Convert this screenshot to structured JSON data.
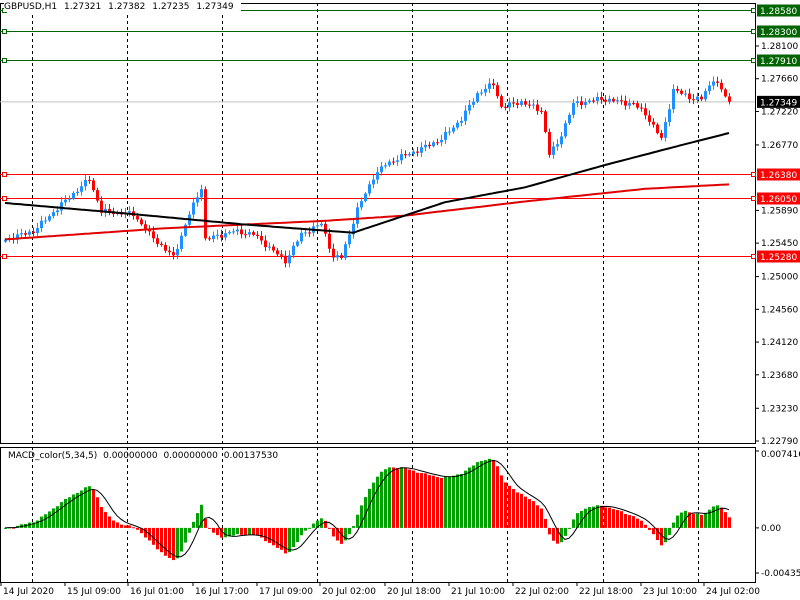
{
  "header": {
    "symbol": "GBPUSD,H1",
    "open": "1.27321",
    "high": "1.27382",
    "low": "1.27235",
    "close": "1.27349"
  },
  "macd": {
    "label": "MACD_color(5,34,5)",
    "v1": "0.00000000",
    "v2": "0.00000000",
    "v3": "0.00137530",
    "axis_top": "0.0074167",
    "axis_zero": "0.00",
    "axis_bottom": "-0.004350",
    "fast": 5,
    "slow": 34,
    "signal": 5
  },
  "colors": {
    "bull": "#1e90ff",
    "bear": "#ff0000",
    "green_line": "#006400",
    "red_line": "#ff0000",
    "ma_black": "#000000",
    "ma_red": "#e00000",
    "macd_up": "#00a000",
    "macd_down": "#ff0000"
  },
  "chart_data": {
    "type": "candlestick",
    "price_range": [
      1.2279,
      1.281
    ],
    "current_price": "1.27349",
    "price_ticks": [
      "1.28100",
      "1.27660",
      "1.27220",
      "1.26770",
      "1.25890",
      "1.25450",
      "1.25000",
      "1.24560",
      "1.24120",
      "1.23680",
      "1.23230",
      "1.22790"
    ],
    "levels": [
      {
        "price": "1.28580",
        "kind": "green"
      },
      {
        "price": "1.28300",
        "kind": "green"
      },
      {
        "price": "1.27910",
        "kind": "green"
      },
      {
        "price": "1.26380",
        "kind": "red"
      },
      {
        "price": "1.26050",
        "kind": "red"
      },
      {
        "price": "1.25280",
        "kind": "red"
      }
    ],
    "time_labels": [
      "14 Jul 2020",
      "15 Jul 09:00",
      "16 Jul 01:00",
      "16 Jul 17:00",
      "17 Jul 09:00",
      "20 Jul 02:00",
      "20 Jul 18:00",
      "21 Jul 10:00",
      "22 Jul 02:00",
      "22 Jul 18:00",
      "23 Jul 10:00",
      "24 Jul 02:00"
    ],
    "close_keypoints": [
      [
        0,
        1.255
      ],
      [
        7,
        1.2561
      ],
      [
        14,
        1.2597
      ],
      [
        21,
        1.2631
      ],
      [
        24,
        1.2588
      ],
      [
        32,
        1.2584
      ],
      [
        36,
        1.2557
      ],
      [
        42,
        1.2526
      ],
      [
        46,
        1.2584
      ],
      [
        49,
        1.262
      ],
      [
        50,
        1.255
      ],
      [
        57,
        1.2561
      ],
      [
        62,
        1.2557
      ],
      [
        70,
        1.2521
      ],
      [
        74,
        1.2557
      ],
      [
        79,
        1.2571
      ],
      [
        82,
        1.2526
      ],
      [
        84,
        1.2526
      ],
      [
        88,
        1.259
      ],
      [
        92,
        1.2634
      ],
      [
        95,
        1.2651
      ],
      [
        99,
        1.2661
      ],
      [
        104,
        1.2672
      ],
      [
        109,
        1.2685
      ],
      [
        114,
        1.2712
      ],
      [
        118,
        1.2746
      ],
      [
        122,
        1.2759
      ],
      [
        124,
        1.2728
      ],
      [
        129,
        1.2735
      ],
      [
        134,
        1.2723
      ],
      [
        136,
        1.2665
      ],
      [
        138,
        1.2678
      ],
      [
        142,
        1.2732
      ],
      [
        149,
        1.2739
      ],
      [
        157,
        1.2732
      ],
      [
        160,
        1.2719
      ],
      [
        164,
        1.2685
      ],
      [
        167,
        1.2751
      ],
      [
        172,
        1.2739
      ],
      [
        174,
        1.2739
      ],
      [
        177,
        1.2766
      ],
      [
        181,
        1.2735
      ]
    ],
    "ma_black": [
      [
        0,
        1.2599
      ],
      [
        30,
        1.2585
      ],
      [
        60,
        1.257
      ],
      [
        87,
        1.2559
      ],
      [
        110,
        1.26
      ],
      [
        130,
        1.262
      ],
      [
        150,
        1.265
      ],
      [
        170,
        1.2678
      ],
      [
        181,
        1.2693
      ]
    ],
    "ma_red": [
      [
        0,
        1.255
      ],
      [
        40,
        1.2565
      ],
      [
        80,
        1.2575
      ],
      [
        100,
        1.2582
      ],
      [
        130,
        1.2601
      ],
      [
        160,
        1.2618
      ],
      [
        181,
        1.2624
      ]
    ]
  }
}
